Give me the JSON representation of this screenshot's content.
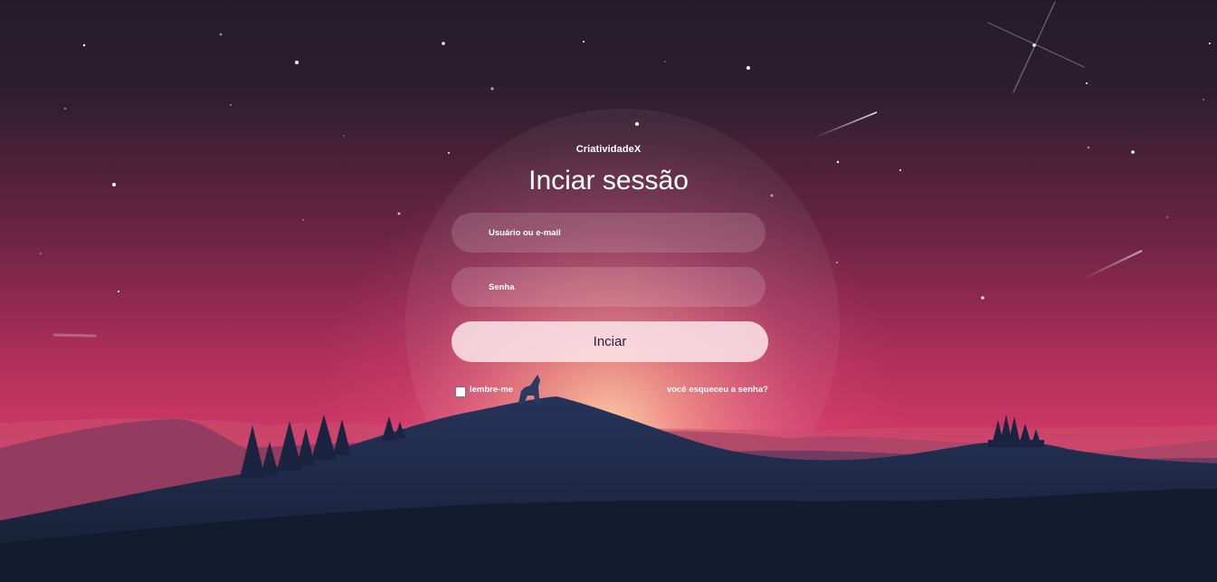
{
  "brand": "CriatividadeX",
  "title": "Inciar sessão",
  "form": {
    "username_placeholder": "Usuário ou e-mail",
    "username_value": "",
    "password_placeholder": "Senha",
    "password_value": "",
    "submit_label": "Inciar",
    "remember_label": "lembre-me",
    "remember_checked": false,
    "forgot_label": "você esqueceu a senha?"
  },
  "colors": {
    "sky_top": "#231c28",
    "sky_mid": "#7a2448",
    "sky_horizon": "#e0396e",
    "glow": "#ffb58a",
    "mountain_dark": "#151d31",
    "mountain_front": "#1e2a48"
  }
}
